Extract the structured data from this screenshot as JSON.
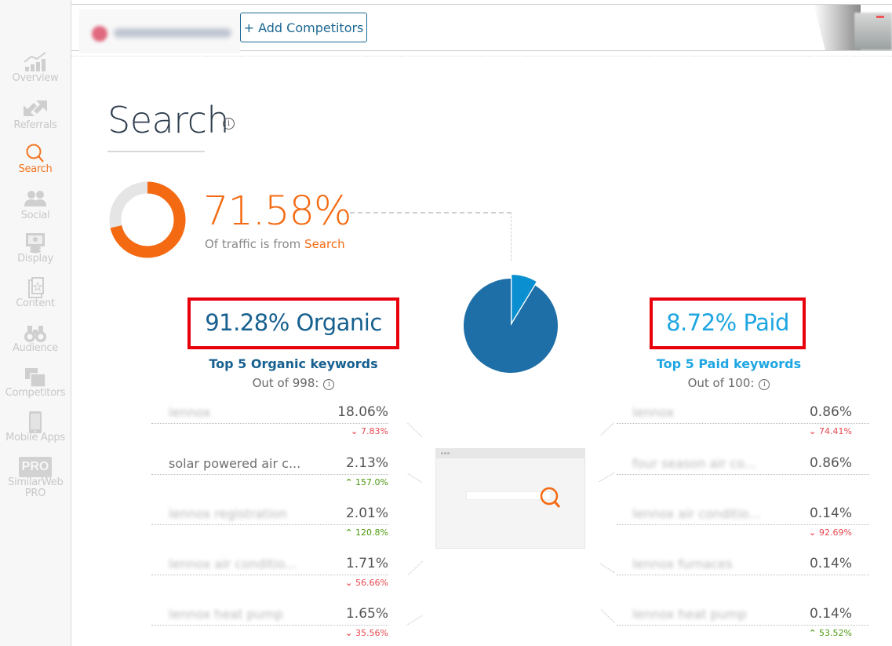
{
  "sidebar": {
    "items": [
      {
        "label": "Overview",
        "icon": "chart-bars-icon",
        "active": false
      },
      {
        "label": "Referrals",
        "icon": "arrows-icon",
        "active": false
      },
      {
        "label": "Search",
        "icon": "search-icon",
        "active": true
      },
      {
        "label": "Social",
        "icon": "people-icon",
        "active": false
      },
      {
        "label": "Display",
        "icon": "display-ad-icon",
        "active": false
      },
      {
        "label": "Content",
        "icon": "content-pages-icon",
        "active": false
      },
      {
        "label": "Audience",
        "icon": "binoculars-icon",
        "active": false
      },
      {
        "label": "Competitors",
        "icon": "windows-icon",
        "active": false
      },
      {
        "label": "Mobile Apps",
        "icon": "phone-icon",
        "active": false
      },
      {
        "label": "SimilarWeb PRO",
        "icon": "pro-badge-icon",
        "badge": "PRO",
        "active": false
      }
    ]
  },
  "topbar": {
    "add_competitors_label": "+ Add Competitors"
  },
  "main": {
    "title": "Search",
    "search_share": {
      "percent": "71.58%",
      "caption_prefix": "Of traffic is from ",
      "caption_highlight": "Search",
      "value": 0.7158
    },
    "organic": {
      "share": "91.28%",
      "label": "Organic",
      "keywords_title": "Top 5 Organic keywords",
      "out_of": "Out of 998:",
      "keywords": [
        {
          "name": "lennox",
          "blurred": true,
          "share": "18.06%",
          "change": "7.83%",
          "direction": "down"
        },
        {
          "name": "solar powered air c...",
          "blurred": false,
          "share": "2.13%",
          "change": "157.0%",
          "direction": "up"
        },
        {
          "name": "lennox registration",
          "blurred": true,
          "share": "2.01%",
          "change": "120.8%",
          "direction": "up"
        },
        {
          "name": "lennox air conditio...",
          "blurred": true,
          "share": "1.71%",
          "change": "56.66%",
          "direction": "down"
        },
        {
          "name": "lennox heat pump",
          "blurred": true,
          "share": "1.65%",
          "change": "35.56%",
          "direction": "down"
        }
      ]
    },
    "paid": {
      "share": "8.72%",
      "label": "Paid",
      "keywords_title": "Top 5 Paid keywords",
      "out_of": "Out of 100:",
      "keywords": [
        {
          "name": "lennox",
          "blurred": true,
          "share": "0.86%",
          "change": "74.41%",
          "direction": "down"
        },
        {
          "name": "four season air co...",
          "blurred": true,
          "share": "0.86%",
          "change": "",
          "direction": ""
        },
        {
          "name": "lennox air conditio...",
          "blurred": true,
          "share": "0.14%",
          "change": "92.69%",
          "direction": "down"
        },
        {
          "name": "lennox furnaces",
          "blurred": true,
          "share": "0.14%",
          "change": "",
          "direction": ""
        },
        {
          "name": "lennox heat pump",
          "blurred": true,
          "share": "0.14%",
          "change": "53.52%",
          "direction": "up"
        }
      ]
    },
    "pie": {
      "organic": 0.9128,
      "paid": 0.0872
    },
    "colors": {
      "search_orange": "#f46a12",
      "organic_blue": "#1e6fa8",
      "paid_blue": "#0a8fd0",
      "highlight_red": "#e8000b",
      "down_red": "#e8474f",
      "up_green": "#4c9a10"
    }
  }
}
